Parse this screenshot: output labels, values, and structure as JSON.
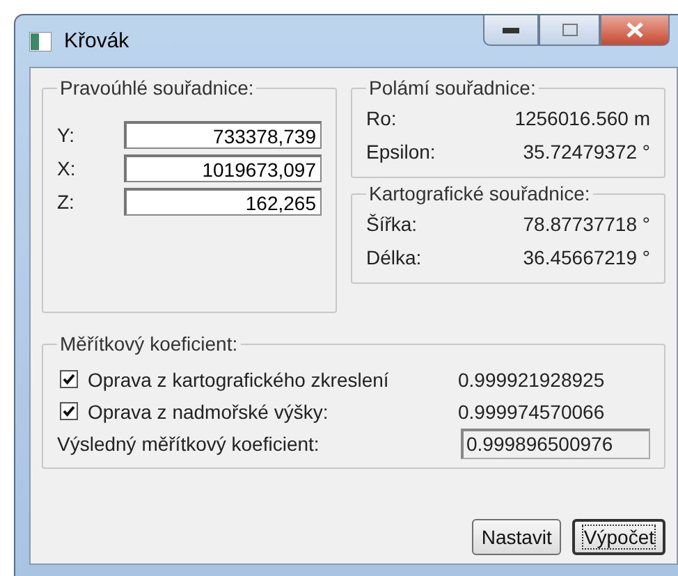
{
  "window": {
    "title": "Křovák"
  },
  "rectangular": {
    "label": "Pravoúhlé souřadnice:",
    "fields": [
      {
        "label": "Y:",
        "value": "733378,739"
      },
      {
        "label": "X:",
        "value": "1019673,097"
      },
      {
        "label": "Z:",
        "value": "162,265"
      }
    ]
  },
  "polar": {
    "label": "Polámí souřadnice:",
    "rows": [
      {
        "label": "Ro:",
        "value": "1256016.560 m"
      },
      {
        "label": "Epsilon:",
        "value": "35.72479372 °"
      }
    ]
  },
  "cartographic": {
    "label": "Kartografické souřadnice:",
    "rows": [
      {
        "label": "Šířka:",
        "value": "78.87737718 °"
      },
      {
        "label": "Délka:",
        "value": "36.45667219 °"
      }
    ]
  },
  "scale": {
    "label": "Měřítkový koeficient:",
    "options": [
      {
        "label": "Oprava z kartografického zkreslení",
        "checked": true,
        "value": "0.999921928925"
      },
      {
        "label": "Oprava z nadmořské výšky:",
        "checked": true,
        "value": "0.999974570066"
      }
    ],
    "result": {
      "label": "Výsledný měřítkový koeficient:",
      "value": "0.999896500976"
    }
  },
  "buttons": [
    {
      "label": "Nastavit",
      "focused": false
    },
    {
      "label": "Výpočet",
      "focused": true
    }
  ]
}
